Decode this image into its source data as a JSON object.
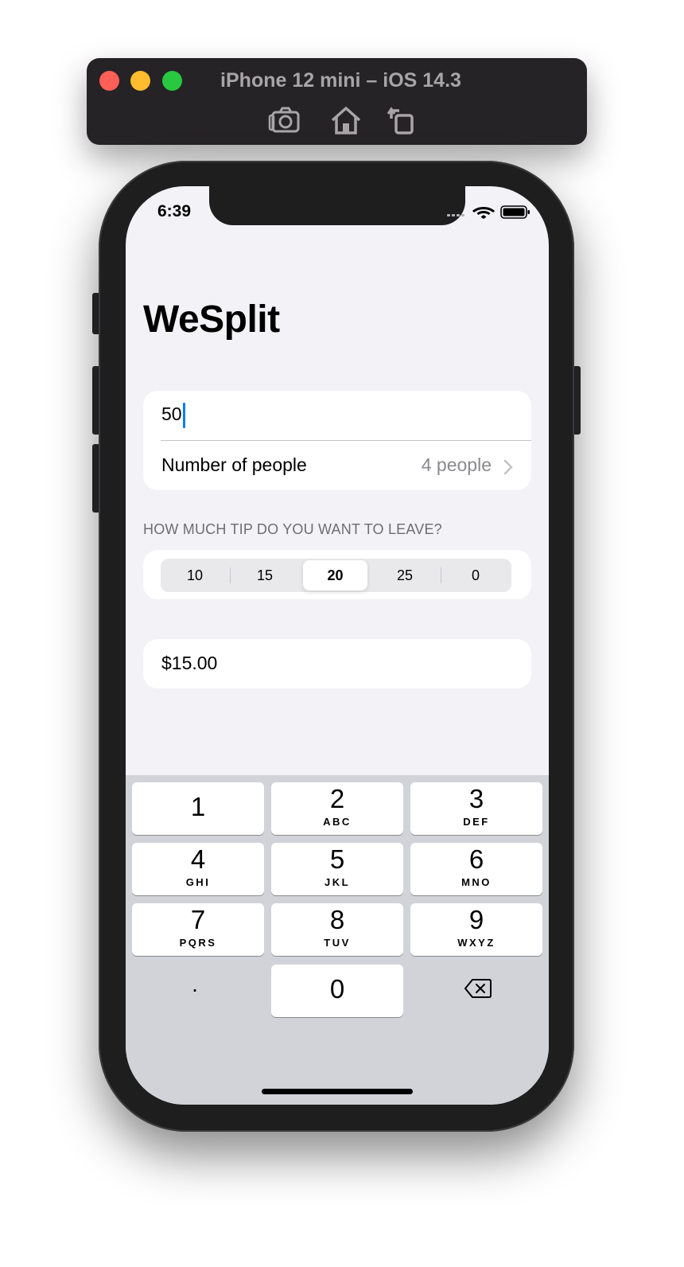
{
  "simulator": {
    "title": "iPhone 12 mini – iOS 14.3",
    "tools": [
      "screenshot-icon",
      "home-icon",
      "rotate-icon"
    ]
  },
  "status_bar": {
    "time": "6:39"
  },
  "app": {
    "title": "WeSplit",
    "amount_value": "50",
    "people_label": "Number of people",
    "people_value": "4 people",
    "tip_header": "HOW MUCH TIP DO YOU WANT TO LEAVE?",
    "tip_options": [
      "10",
      "15",
      "20",
      "25",
      "0"
    ],
    "tip_selected": "20",
    "total": "$15.00"
  },
  "keyboard": {
    "keys": [
      {
        "num": "1",
        "letters": ""
      },
      {
        "num": "2",
        "letters": "ABC"
      },
      {
        "num": "3",
        "letters": "DEF"
      },
      {
        "num": "4",
        "letters": "GHI"
      },
      {
        "num": "5",
        "letters": "JKL"
      },
      {
        "num": "6",
        "letters": "MNO"
      },
      {
        "num": "7",
        "letters": "PQRS"
      },
      {
        "num": "8",
        "letters": "TUV"
      },
      {
        "num": "9",
        "letters": "WXYZ"
      }
    ],
    "decimal": ".",
    "zero": "0"
  },
  "colors": {
    "accent": "#0a7aff",
    "background": "#f2f2f7",
    "secondary_text": "#8a8a8e"
  }
}
